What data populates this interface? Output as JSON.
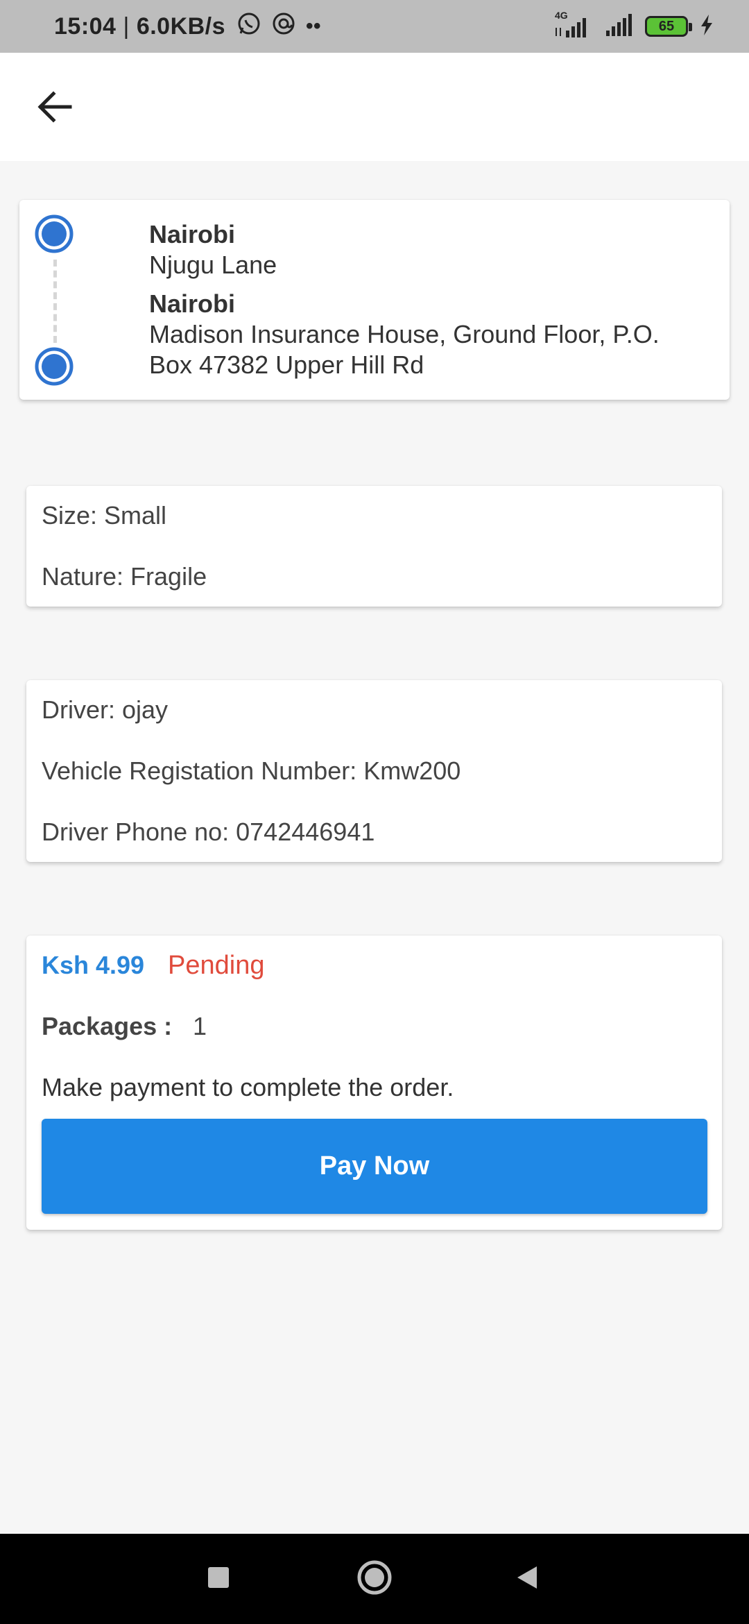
{
  "status_bar": {
    "time": "15:04",
    "separator": "|",
    "net_speed": "6.0KB/s",
    "dots": "••",
    "network_type": "4G",
    "battery": "65"
  },
  "route": {
    "pickup": {
      "city": "Nairobi",
      "address": "Njugu Lane"
    },
    "dropoff": {
      "city": "Nairobi",
      "address": "Madison Insurance House, Ground Floor, P.O. Box 47382 Upper Hill Rd"
    }
  },
  "package": {
    "size": "Size: Small",
    "nature": "Nature: Fragile"
  },
  "driver": {
    "name": "Driver: ojay",
    "vehicle": "Vehicle Registation Number: Kmw200",
    "phone": "Driver Phone no: 0742446941"
  },
  "payment": {
    "price": "Ksh 4.99",
    "status": "Pending",
    "packages_label": "Packages :",
    "packages_value": "1",
    "message": "Make payment to complete the order.",
    "button_label": "Pay Now"
  },
  "colors": {
    "accent": "#1f88e5",
    "price": "#2a86da",
    "pending": "#e04b3c",
    "route_dot": "#2f74d0"
  },
  "icons": {
    "back": "arrow-left-icon",
    "nav_recent": "square-icon",
    "nav_home": "circle-icon",
    "nav_back": "triangle-left-icon"
  }
}
